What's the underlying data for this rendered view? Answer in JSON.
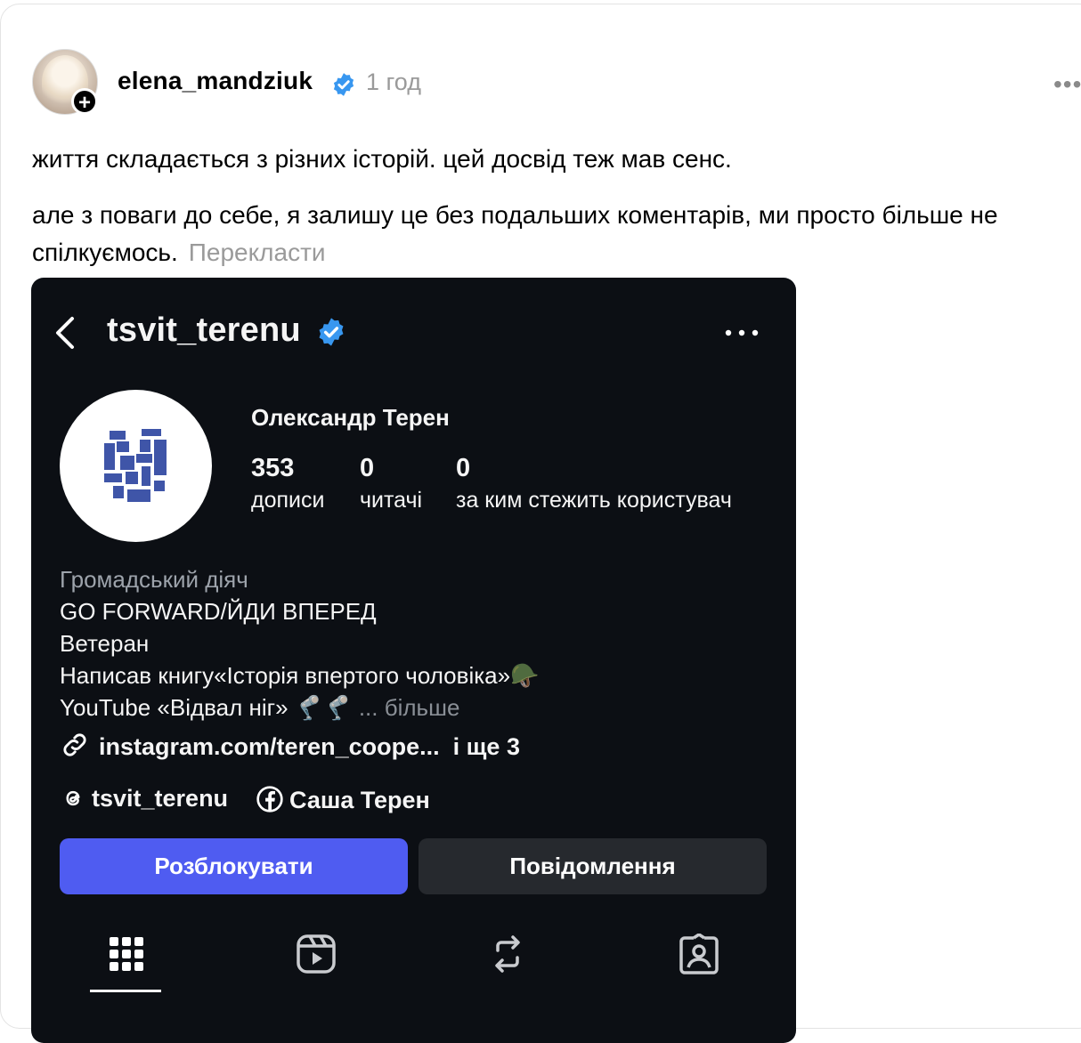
{
  "post": {
    "username": "elena_mandziuk",
    "time": "1 год",
    "text_1": "життя складається з різних історій. цей досвід теж мав сенс.",
    "text_2": "але з поваги до себе, я залишу це без подальших коментарів, ми просто більше не спілкуємось.",
    "translate": "Перекласти",
    "more_icon": "more-horizontal-icon",
    "accent_color": "#3897f0"
  },
  "profile": {
    "handle": "tsvit_terenu",
    "full_name": "Олександр Терен",
    "stats": [
      {
        "value": "353",
        "label": "дописи"
      },
      {
        "value": "0",
        "label": "читачі"
      },
      {
        "value": "0",
        "label": "за ким стежить користувач"
      }
    ],
    "bio": {
      "category": "Громадський діяч",
      "line_1": "GO FORWARD/ЙДИ ВПЕРЕД",
      "line_2": "Ветеран",
      "line_3": "Написав книгу«Історія впертого чоловіка»🪖",
      "line_4": "YouTube «Відвал ніг» 🦿🦿",
      "more": "... більше"
    },
    "link": "instagram.com/teren_coope...",
    "link_more": "і ще 3",
    "threads": "tsvit_terenu",
    "facebook": "Саша Терен",
    "unblock": "Розблокувати",
    "message": "Повідомлення",
    "button_color": "#4f5cf1",
    "tabs": [
      "grid-icon",
      "reels-icon",
      "reposts-icon",
      "tagged-icon"
    ]
  }
}
